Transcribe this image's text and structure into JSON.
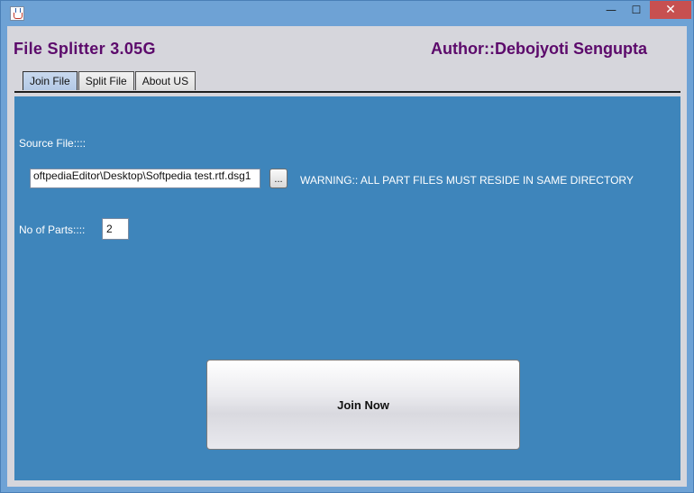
{
  "window": {
    "controls": {
      "minimize": "—",
      "maximize": "☐",
      "close": "✕"
    }
  },
  "header": {
    "app_title": "File Splitter 3.05G",
    "author": "Author::Debojyoti Sengupta"
  },
  "tabs": [
    {
      "label": "Join File",
      "active": true
    },
    {
      "label": "Split File",
      "active": false
    },
    {
      "label": "About US",
      "active": false
    }
  ],
  "join_panel": {
    "source_label": "Source File::::",
    "source_value": "oftpediaEditor\\Desktop\\Softpedia test.rtf.dsg1",
    "browse_label": "...",
    "warning": "WARNING:: ALL PART FILES MUST RESIDE IN SAME DIRECTORY",
    "parts_label": "No of Parts::::",
    "parts_value": "2",
    "join_button": "Join Now"
  },
  "colors": {
    "panel_bg": "#3e85bb",
    "title_text": "#5c0a6b",
    "frame": "#6ea2d5",
    "close_button": "#c75050"
  },
  "icons": {
    "app": "java-cup-icon",
    "minimize": "minimize-icon",
    "maximize": "maximize-icon",
    "close": "close-icon"
  }
}
